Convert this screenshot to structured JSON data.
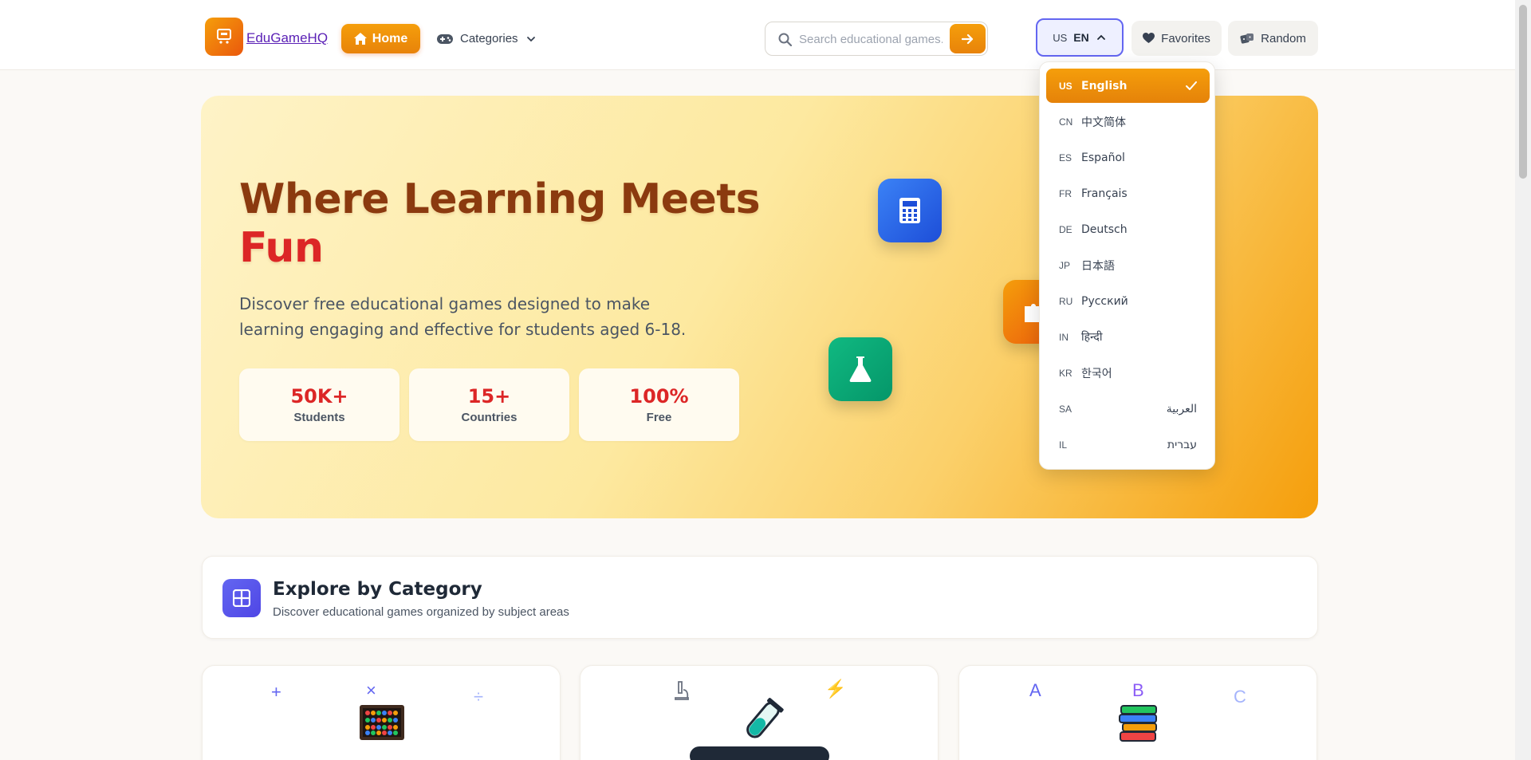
{
  "header": {
    "logo_text": "EduGameHQ",
    "home_label": "Home",
    "categories_label": "Categories",
    "search_placeholder": "Search educational games...",
    "lang_country": "US",
    "lang_code": "EN",
    "favorites_label": "Favorites",
    "random_label": "Random"
  },
  "hero": {
    "title_line1": "Where Learning Meets",
    "title_accent": "Fun",
    "subtitle": "Discover free educational games designed to make learning engaging and effective for students aged 6-18.",
    "stats": [
      {
        "value": "50K+",
        "label": "Students"
      },
      {
        "value": "15+",
        "label": "Countries"
      },
      {
        "value": "100%",
        "label": "Free"
      }
    ]
  },
  "explore": {
    "title": "Explore by Category",
    "subtitle": "Discover educational games organized by subject areas"
  },
  "cards": [
    {
      "symbols": [
        "+",
        "×",
        "÷"
      ]
    },
    {
      "symbols": [
        "⚡"
      ]
    },
    {
      "symbols": [
        "A",
        "B",
        "C"
      ]
    }
  ],
  "language_menu": {
    "selected": "English",
    "options": [
      {
        "cc": "US",
        "name": "English"
      },
      {
        "cc": "CN",
        "name": "中文简体"
      },
      {
        "cc": "ES",
        "name": "Español"
      },
      {
        "cc": "FR",
        "name": "Français"
      },
      {
        "cc": "DE",
        "name": "Deutsch"
      },
      {
        "cc": "JP",
        "name": "日本語"
      },
      {
        "cc": "RU",
        "name": "Русский"
      },
      {
        "cc": "IN",
        "name": "हिन्दी"
      },
      {
        "cc": "KR",
        "name": "한국어"
      },
      {
        "cc": "SA",
        "name": "العربية"
      },
      {
        "cc": "IL",
        "name": "עברית"
      }
    ]
  },
  "colors": {
    "brand_orange": "#f59e0b",
    "accent_red": "#dc2626",
    "title_brown": "#8b3a0f",
    "indigo": "#6366f1"
  }
}
